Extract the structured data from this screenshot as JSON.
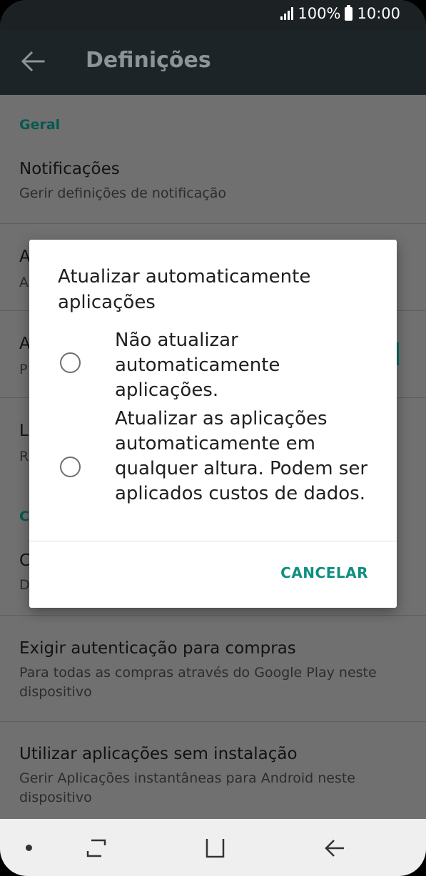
{
  "status_bar": {
    "battery": "100%",
    "time": "10:00"
  },
  "app_bar": {
    "title": "Definições"
  },
  "settings": {
    "section_general": "Geral",
    "notifications_title": "Notificações",
    "notifications_sub": "Gerir definições de notificação",
    "clipped_rows": [
      {
        "title": "A",
        "sub": "A"
      },
      {
        "title": "A",
        "sub": "P"
      },
      {
        "title": "L",
        "sub": "R"
      }
    ],
    "section_clipped": "C",
    "clipped_row_4": {
      "title": "C",
      "sub": "D"
    },
    "auth_title": "Exigir autenticação para compras",
    "auth_sub": "Para todas as compras através do Google Play neste dispositivo",
    "instant_title": "Utilizar aplicações sem instalação",
    "instant_sub": "Gerir Aplicações instantâneas para Android neste dispositivo"
  },
  "dialog": {
    "title": "Atualizar automaticamente aplicações",
    "options": [
      {
        "label": "Não atualizar automaticamente aplicações.",
        "selected": false
      },
      {
        "label": "Atualizar as aplicações automaticamente em qualquer altura. Podem ser aplicados custos de dados.",
        "selected": false
      }
    ],
    "cancel_label": "CANCELAR"
  },
  "colors": {
    "accent": "#0f8f81",
    "app_bar": "#1c2428",
    "scrim_bg": "#707070"
  }
}
